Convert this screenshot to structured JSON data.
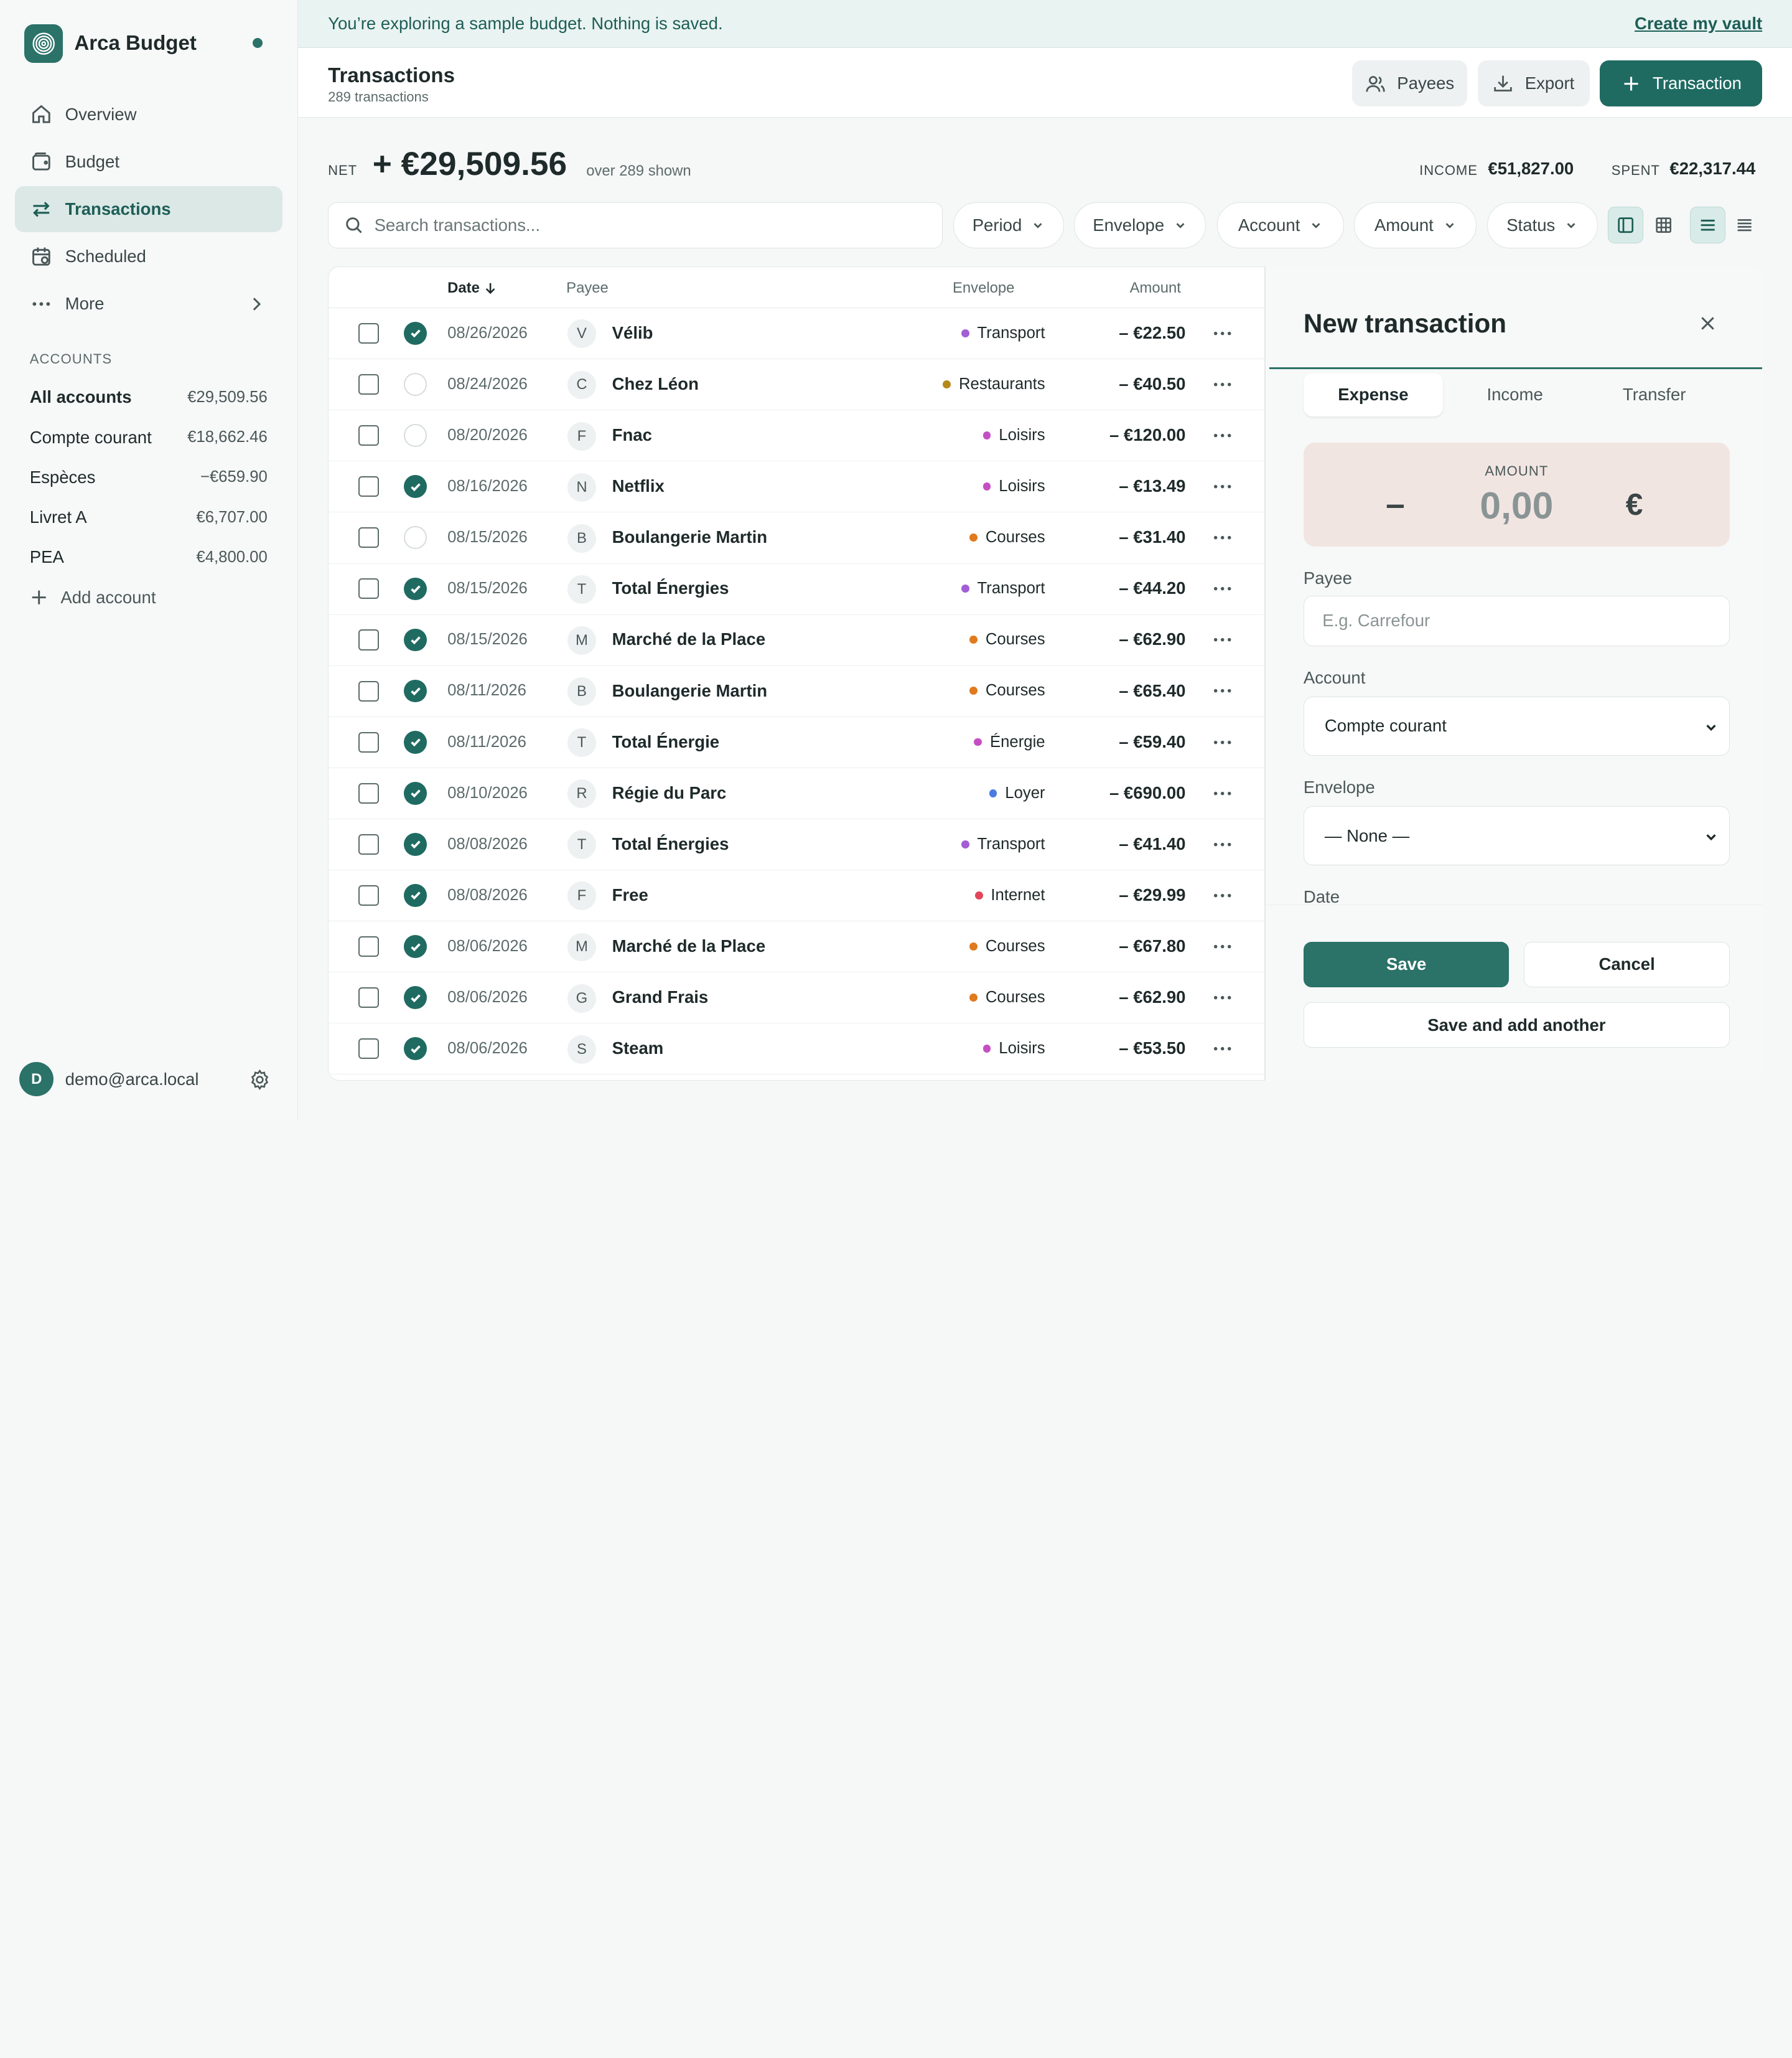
{
  "app": {
    "name": "Arca Budget"
  },
  "nav": [
    {
      "label": "Overview",
      "icon": "home-icon"
    },
    {
      "label": "Budget",
      "icon": "wallet-icon"
    },
    {
      "label": "Transactions",
      "icon": "transfer-arrows-icon",
      "active": true
    },
    {
      "label": "Scheduled",
      "icon": "calendar-clock-icon"
    },
    {
      "label": "More",
      "icon": "dots-icon"
    }
  ],
  "accounts": {
    "heading": "ACCOUNTS",
    "items": [
      {
        "name": "All accounts",
        "balance": "€29,509.56"
      },
      {
        "name": "Compte courant",
        "balance": "€18,662.46"
      },
      {
        "name": "Espèces",
        "balance": "−€659.90"
      },
      {
        "name": "Livret A",
        "balance": "€6,707.00"
      },
      {
        "name": "PEA",
        "balance": "€4,800.00"
      }
    ],
    "add_label": "Add account"
  },
  "user": {
    "initial": "D",
    "email": "demo@arca.local"
  },
  "banner": {
    "text": "You’re exploring a sample budget. Nothing is saved.",
    "link": "Create my vault"
  },
  "header": {
    "title": "Transactions",
    "subtitle": "289 transactions",
    "payees_label": "Payees",
    "export_label": "Export",
    "add_label": "Transaction"
  },
  "summary": {
    "net_label": "NET",
    "net_value": "+ €29,509.56",
    "net_note": "over 289 shown",
    "income_label": "INCOME",
    "income_value": "€51,827.00",
    "spent_label": "SPENT",
    "spent_value": "€22,317.44"
  },
  "filters": {
    "search_placeholder": "Search transactions...",
    "period": "Period",
    "envelope": "Envelope",
    "account": "Account",
    "amount": "Amount",
    "status": "Status"
  },
  "table": {
    "columns": {
      "date": "Date",
      "payee": "Payee",
      "envelope": "Envelope",
      "amount": "Amount"
    },
    "rows": [
      {
        "cleared": true,
        "date": "08/26/2026",
        "initial": "V",
        "payee": "Vélib",
        "envelope": "Transport",
        "env_color": "#a35ed6",
        "amount": "– €22.50"
      },
      {
        "cleared": false,
        "date": "08/24/2026",
        "initial": "C",
        "payee": "Chez Léon",
        "envelope": "Restaurants",
        "env_color": "#b58a1a",
        "amount": "– €40.50"
      },
      {
        "cleared": false,
        "date": "08/20/2026",
        "initial": "F",
        "payee": "Fnac",
        "envelope": "Loisirs",
        "env_color": "#c44fc4",
        "amount": "– €120.00"
      },
      {
        "cleared": true,
        "date": "08/16/2026",
        "initial": "N",
        "payee": "Netflix",
        "envelope": "Loisirs",
        "env_color": "#c44fc4",
        "amount": "– €13.49"
      },
      {
        "cleared": false,
        "date": "08/15/2026",
        "initial": "B",
        "payee": "Boulangerie Martin",
        "envelope": "Courses",
        "env_color": "#e07a1f",
        "amount": "– €31.40"
      },
      {
        "cleared": true,
        "date": "08/15/2026",
        "initial": "T",
        "payee": "Total Énergies",
        "envelope": "Transport",
        "env_color": "#a35ed6",
        "amount": "– €44.20"
      },
      {
        "cleared": true,
        "date": "08/15/2026",
        "initial": "M",
        "payee": "Marché de la Place",
        "envelope": "Courses",
        "env_color": "#e07a1f",
        "amount": "– €62.90"
      },
      {
        "cleared": true,
        "date": "08/11/2026",
        "initial": "B",
        "payee": "Boulangerie Martin",
        "envelope": "Courses",
        "env_color": "#e07a1f",
        "amount": "– €65.40"
      },
      {
        "cleared": true,
        "date": "08/11/2026",
        "initial": "T",
        "payee": "Total Énergie",
        "envelope": "Énergie",
        "env_color": "#c44fc4",
        "amount": "– €59.40"
      },
      {
        "cleared": true,
        "date": "08/10/2026",
        "initial": "R",
        "payee": "Régie du Parc",
        "envelope": "Loyer",
        "env_color": "#4a7be0",
        "amount": "– €690.00"
      },
      {
        "cleared": true,
        "date": "08/08/2026",
        "initial": "T",
        "payee": "Total Énergies",
        "envelope": "Transport",
        "env_color": "#a35ed6",
        "amount": "– €41.40"
      },
      {
        "cleared": true,
        "date": "08/08/2026",
        "initial": "F",
        "payee": "Free",
        "envelope": "Internet",
        "env_color": "#e0485a",
        "amount": "– €29.99"
      },
      {
        "cleared": true,
        "date": "08/06/2026",
        "initial": "M",
        "payee": "Marché de la Place",
        "envelope": "Courses",
        "env_color": "#e07a1f",
        "amount": "– €67.80"
      },
      {
        "cleared": true,
        "date": "08/06/2026",
        "initial": "G",
        "payee": "Grand Frais",
        "envelope": "Courses",
        "env_color": "#e07a1f",
        "amount": "– €62.90"
      },
      {
        "cleared": true,
        "date": "08/06/2026",
        "initial": "S",
        "payee": "Steam",
        "envelope": "Loisirs",
        "env_color": "#c44fc4",
        "amount": "– €53.50"
      }
    ]
  },
  "drawer": {
    "title": "New transaction",
    "tabs": [
      "Expense",
      "Income",
      "Transfer"
    ],
    "active_tab": "Expense",
    "amount_label": "AMOUNT",
    "amount_sign": "–",
    "amount_value": "0,00",
    "currency": "€",
    "payee_label": "Payee",
    "payee_placeholder": "E.g. Carrefour",
    "account_label": "Account",
    "account_value": "Compte courant",
    "envelope_label": "Envelope",
    "envelope_value": "— None —",
    "date_label": "Date",
    "save": "Save",
    "cancel": "Cancel",
    "save_another": "Save and add another"
  },
  "colors": {
    "accent": "#2b7268",
    "accent_dark": "#1f6b62",
    "amount_bg": "#f1e5e2"
  }
}
